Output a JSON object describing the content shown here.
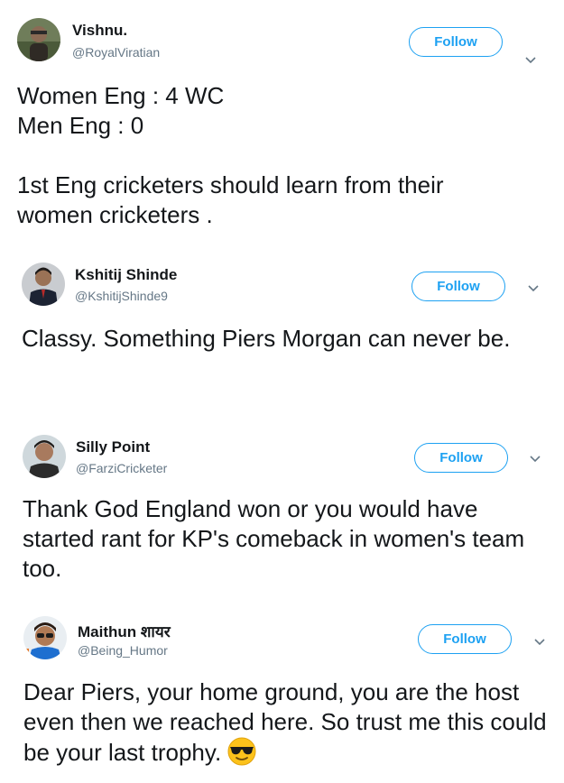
{
  "tweets": [
    {
      "display_name": "Vishnu.",
      "handle": "@RoyalViratian",
      "follow_label": "Follow",
      "text": "Women Eng : 4 WC\nMen Eng : 0\n\n1st Eng cricketers should learn  from their women cricketers ."
    },
    {
      "display_name": "Kshitij Shinde",
      "handle": "@KshitijShinde9",
      "follow_label": "Follow",
      "text": "Classy. Something Piers Morgan can never be."
    },
    {
      "display_name": "Silly Point",
      "handle": "@FarziCricketer",
      "follow_label": "Follow",
      "text": "Thank God England won or you would have started rant for KP's comeback in women's team too."
    },
    {
      "display_name": "Maithun शायर",
      "handle": "@Being_Humor",
      "follow_label": "Follow",
      "text": "Dear Piers, your home ground, you are the host even then we reached here. So trust me this could be your last trophy.",
      "emoji": "smiling-face-with-sunglasses"
    }
  ],
  "colors": {
    "accent": "#1da1f2",
    "text": "#14171a",
    "secondary_text": "#657786",
    "chevron": "#657786"
  },
  "icons": [
    "avatar",
    "chevron-down-icon",
    "sunglasses-emoji-icon"
  ]
}
